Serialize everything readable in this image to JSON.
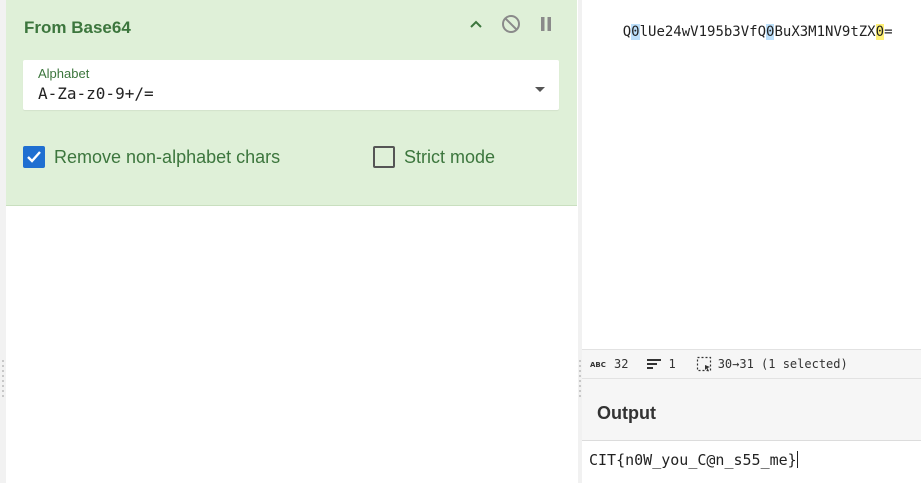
{
  "operation": {
    "title": "From Base64",
    "alphabet_label": "Alphabet",
    "alphabet_value": "A-Za-z0-9+/=",
    "remove_nonalpha_label": "Remove non-alphabet chars",
    "remove_nonalpha_checked": true,
    "strict_mode_label": "Strict mode",
    "strict_mode_checked": false,
    "icons": [
      "chevron-up-icon",
      "disable-icon",
      "pause-icon",
      "dropdown-caret-icon"
    ]
  },
  "input": {
    "segments": [
      {
        "text": "Q",
        "hl": ""
      },
      {
        "text": "0",
        "hl": "blue"
      },
      {
        "text": "lUe24wV195b3VfQ",
        "hl": ""
      },
      {
        "text": "0",
        "hl": "blue"
      },
      {
        "text": "BuX3M1NV9tZX",
        "hl": ""
      },
      {
        "text": "0",
        "hl": "yellow"
      },
      {
        "text": "=",
        "hl": ""
      }
    ]
  },
  "status": {
    "length": "32",
    "lines": "1",
    "selection": "30→31 (1 selected)"
  },
  "output": {
    "title": "Output",
    "text": "CIT{n0W_you_C@n_s55_me}"
  },
  "colors": {
    "operation_bg": "#dff0d8",
    "operation_text": "#3c763d",
    "checkbox_checked": "#1f6fd1",
    "highlight_blue": "#bde0fb",
    "highlight_yellow": "#fff176"
  }
}
